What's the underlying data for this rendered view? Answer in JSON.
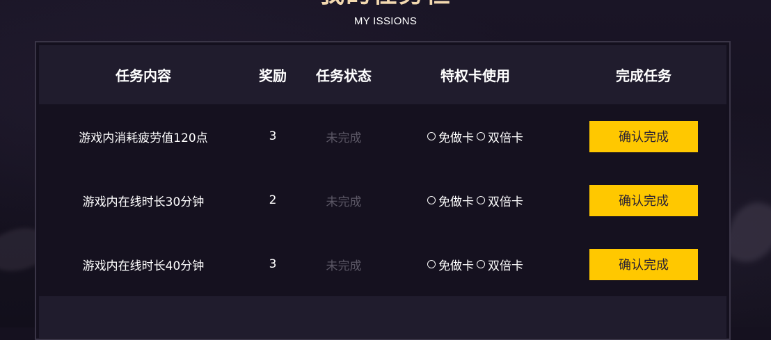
{
  "header": {
    "title": "我的任务栏",
    "subtitle": "MY ISSIONS"
  },
  "table": {
    "columns": [
      "任务内容",
      "奖励",
      "任务状态",
      "特权卡使用",
      "完成任务"
    ],
    "rows": [
      {
        "task": "游戏内消耗疲劳值120点",
        "reward": "3",
        "status": "未完成",
        "privilege_a": "免做卡",
        "privilege_b": "双倍卡",
        "action": "确认完成"
      },
      {
        "task": "游戏内在线时长30分钟",
        "reward": "2",
        "status": "未完成",
        "privilege_a": "免做卡",
        "privilege_b": "双倍卡",
        "action": "确认完成"
      },
      {
        "task": "游戏内在线时长40分钟",
        "reward": "3",
        "status": "未完成",
        "privilege_a": "免做卡",
        "privilege_b": "双倍卡",
        "action": "确认完成"
      }
    ]
  },
  "colors": {
    "accent": "#ffc800",
    "title": "#f3d9b0",
    "background": "#15111f",
    "header_band": "#201c2d",
    "status_inactive": "#5c5866"
  }
}
